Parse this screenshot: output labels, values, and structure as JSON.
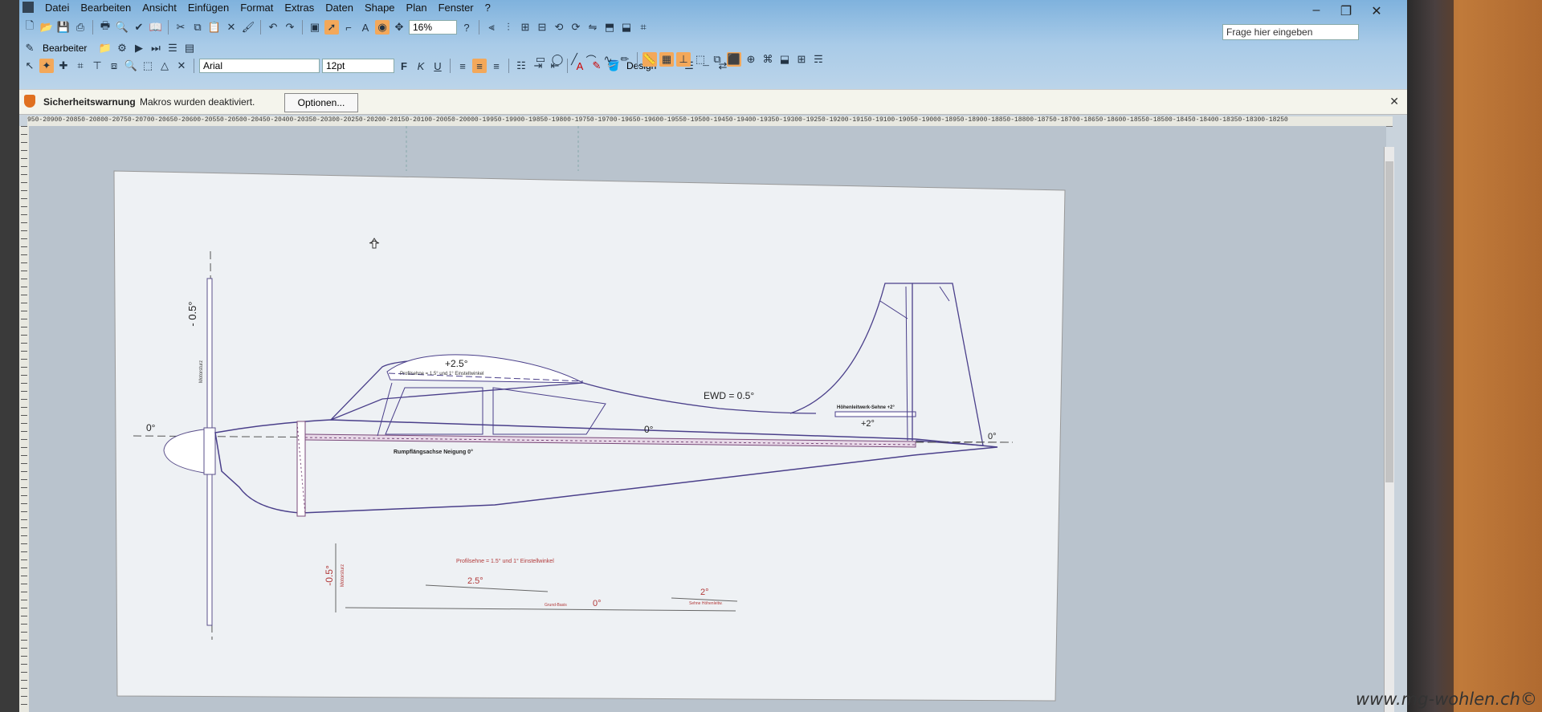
{
  "menu": [
    "Datei",
    "Bearbeiten",
    "Ansicht",
    "Einfügen",
    "Format",
    "Extras",
    "Daten",
    "Shape",
    "Plan",
    "Fenster",
    "?"
  ],
  "toolbar": {
    "zoom": "16%",
    "stencil_label": "Bearbeiter",
    "font": "Arial",
    "font_size": "12pt",
    "bold": "F",
    "italic": "K",
    "underline": "U",
    "design_label": "Design"
  },
  "help_box": {
    "placeholder": "Frage hier eingeben"
  },
  "security_bar": {
    "title": "Sicherheitswarnung",
    "message": "Makros wurden deaktiviert.",
    "options_button": "Optionen..."
  },
  "ruler": {
    "labels": "950-20900-20850-20800-20750-20700-20650-20600-20550-20500-20450-20400-20350-20300-20250-20200-20150-20100-20050-20000-19950-19900-19850-19800-19750-19700-19650-19600-19550-19500-19450-19400-19350-19300-19250-19200-19150-19100-19050-19000-18950-18900-18850-18800-18750-18700-18650-18600-18550-18500-18450-18400-18350-18300-18250"
  },
  "drawing": {
    "labels": {
      "prop_angle": "- 0.5°",
      "zero_left": "0°",
      "motorsturz": "Motorsturz",
      "wing_angle": "+2.5°",
      "wing_note": "Profilsehne = 1.5° und 1° Einstellwinkel",
      "ewd": "EWD = 0.5°",
      "zero_mid": "0°",
      "fuselage_axis": "Rumpflängsachse  Neigung  0°",
      "tail_note": "Höhenleitwerk-Sehne  +2°",
      "tail_angle": "+2°",
      "zero_right": "0°"
    },
    "legend": {
      "angle_left": "-0.5°",
      "motor_small": "Motorsturz",
      "note": "Profilsehne = 1.5° und 1° Einstellwinkel",
      "wing": "2.5°",
      "base_small": "Grund-Basis",
      "zero": "0°",
      "tail": "2°",
      "tail_small": "Sehne Höhenleitw."
    }
  },
  "watermark": "www.mg-wohlen.ch©",
  "colors": {
    "appbar": "#7fb2dd",
    "accent": "#f3a85a",
    "ink": "#4a3f8a",
    "hatch": "#7a4a7a",
    "legend": "#b23a3a"
  }
}
